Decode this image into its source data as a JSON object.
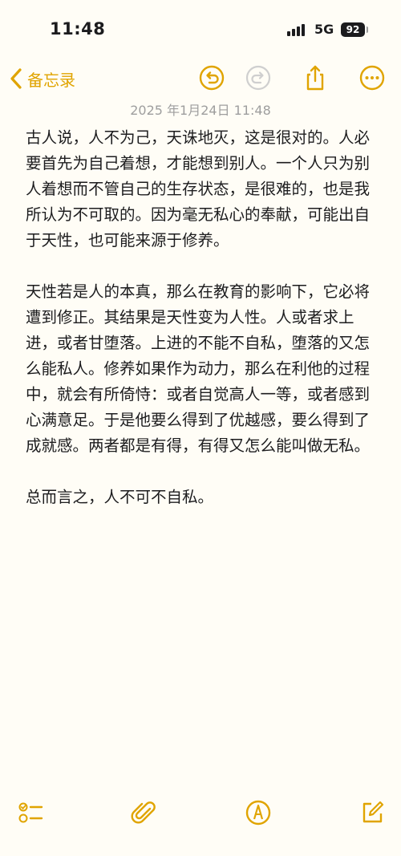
{
  "status_bar": {
    "time": "11:48",
    "network": "5G",
    "battery_level": "92"
  },
  "nav": {
    "back_label": "备忘录",
    "icons": [
      "chevron-left-icon",
      "undo-icon",
      "redo-icon",
      "share-icon",
      "more-icon"
    ]
  },
  "note": {
    "date": "2025 年1月24日 11:48",
    "paragraphs": [
      "古人说，人不为己，天诛地灭，这是很对的。人必要首先为自己着想，才能想到别人。一个人只为别人着想而不管自己的生存状态，是很难的，也是我所认为不可取的。因为毫无私心的奉献，可能出自于天性，也可能来源于修养。",
      "天性若是人的本真，那么在教育的影响下，它必将遭到修正。其结果是天性变为人性。人或者求上进，或者甘堕落。上进的不能不自私，堕落的又怎么能私人。修养如果作为动力，那么在利他的过程中，就会有所倚恃：或者自觉高人一等，或者感到心满意足。于是他要么得到了优越感，要么得到了成就感。两者都是有得，有得又怎么能叫做无私。",
      "总而言之，人不可不自私。"
    ]
  },
  "toolbar": {
    "icons": [
      "checklist-icon",
      "attachment-icon",
      "markup-pen-icon",
      "compose-icon"
    ]
  },
  "colors": {
    "accent": "#e0a400",
    "background": "#fffdf6",
    "text": "#1c1c1e",
    "date_text": "#9e9e9e"
  }
}
